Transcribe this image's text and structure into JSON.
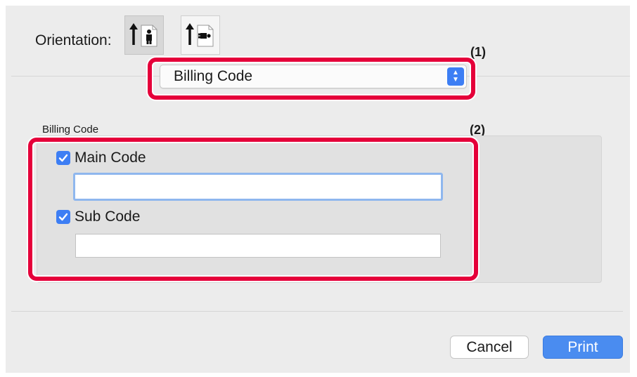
{
  "orientation": {
    "label": "Orientation:",
    "options": [
      {
        "name": "portrait",
        "icon": "portrait-orientation-icon",
        "selected": true
      },
      {
        "name": "landscape",
        "icon": "landscape-orientation-icon",
        "selected": false
      }
    ]
  },
  "annotations": {
    "first": "(1)",
    "second": "(2)"
  },
  "panel_popup": {
    "selected": "Billing Code"
  },
  "billing": {
    "section_title": "Billing Code",
    "main_code": {
      "label": "Main Code",
      "checked": true,
      "value": ""
    },
    "sub_code": {
      "label": "Sub Code",
      "checked": true,
      "value": ""
    }
  },
  "buttons": {
    "cancel": "Cancel",
    "print": "Print"
  },
  "colors": {
    "highlight": "#e5003a",
    "accent": "#3d7ef4",
    "print_button": "#4a8cf0"
  }
}
